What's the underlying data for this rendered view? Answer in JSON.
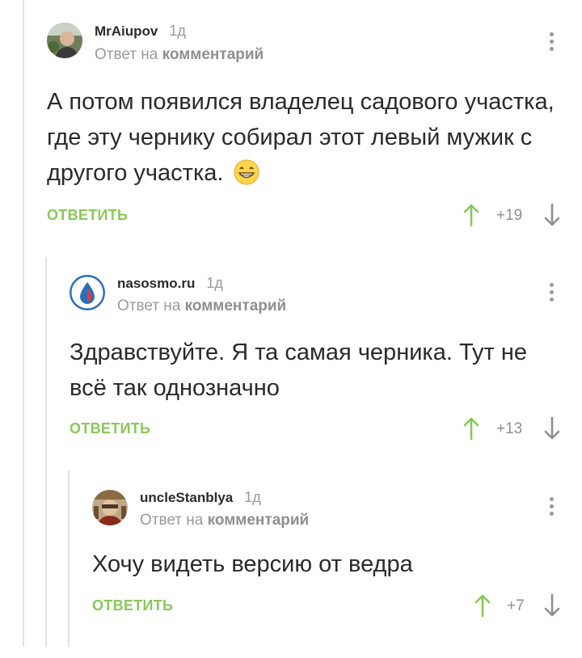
{
  "comments": [
    {
      "author": "MrAiupov",
      "time": "1д",
      "reply_prefix": "Ответ на",
      "reply_target": "комментарий",
      "text": "А потом появился владелец садового участка, где эту чернику собирал этот левый мужик с другого участка.",
      "emoji": "grinning-emoji",
      "reply_label": "ОТВЕТИТЬ",
      "rating": "+19"
    },
    {
      "author": "nasosmo.ru",
      "time": "1д",
      "reply_prefix": "Ответ на",
      "reply_target": "комментарий",
      "text": "Здравствуйте. Я та самая черника. Тут не всё так однозначно",
      "reply_label": "ОТВЕТИТЬ",
      "rating": "+13"
    },
    {
      "author": "uncleStanblya",
      "time": "1д",
      "reply_prefix": "Ответ на",
      "reply_target": "комментарий",
      "text": "Хочу видеть версию от ведра",
      "reply_label": "ОТВЕТИТЬ",
      "rating": "+7"
    }
  ],
  "colors": {
    "accent": "#8ac858",
    "muted": "#9a9a9a",
    "thread": "#e4e4e4"
  },
  "icons": [
    "kebab-menu-icon",
    "upvote-arrow-icon",
    "downvote-arrow-icon",
    "grinning-emoji"
  ]
}
